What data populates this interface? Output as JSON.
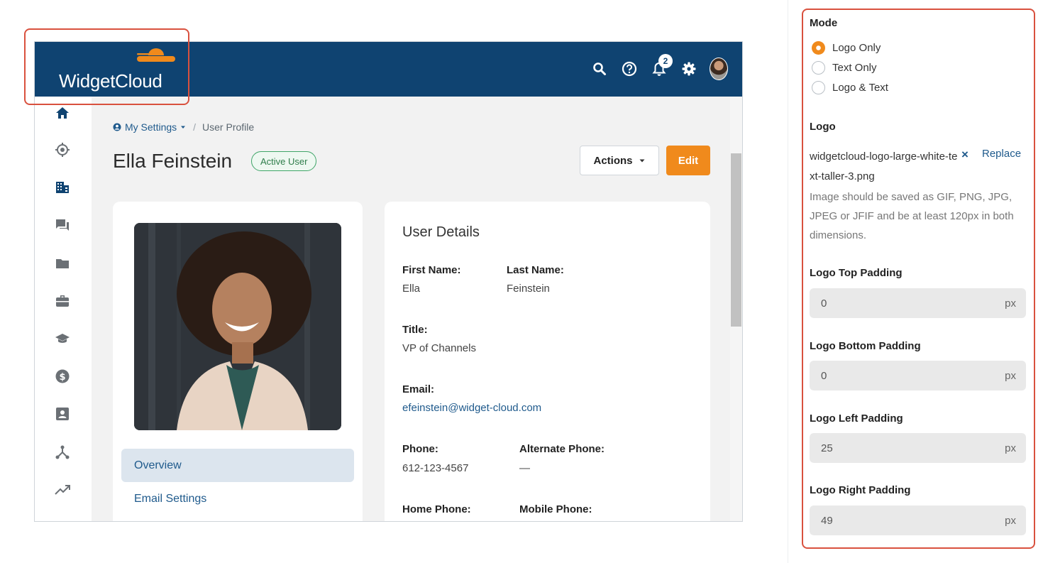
{
  "header": {
    "brand": "WidgetCloud",
    "notifications_count": "2"
  },
  "breadcrumb": {
    "root": "My Settings",
    "current": "User Profile"
  },
  "profile": {
    "name": "Ella Feinstein",
    "status": "Active User",
    "actions_label": "Actions",
    "edit_label": "Edit"
  },
  "profile_nav": [
    "Overview",
    "Email Settings"
  ],
  "details": {
    "title": "User Details",
    "first_name_label": "First Name:",
    "first_name": "Ella",
    "last_name_label": "Last Name:",
    "last_name": "Feinstein",
    "title_label": "Title:",
    "title_value": "VP of Channels",
    "email_label": "Email:",
    "email": "efeinstein@widget-cloud.com",
    "phone_label": "Phone:",
    "phone": "612-123-4567",
    "alt_phone_label": "Alternate Phone:",
    "alt_phone": "—",
    "home_phone_label": "Home Phone:",
    "mobile_phone_label": "Mobile Phone:"
  },
  "settings": {
    "mode_label": "Mode",
    "mode_options": [
      "Logo Only",
      "Text Only",
      "Logo & Text"
    ],
    "mode_selected": "Logo Only",
    "logo_label": "Logo",
    "logo_file": "widgetcloud-logo-large-white-text-taller-3.png",
    "replace_label": "Replace",
    "hint": "Image should be saved as GIF, PNG, JPG, JPEG or JFIF and be at least 120px in both dimensions.",
    "top_padding_label": "Logo Top Padding",
    "top_padding": "0",
    "bottom_padding_label": "Logo Bottom Padding",
    "bottom_padding": "0",
    "left_padding_label": "Logo Left Padding",
    "left_padding": "25",
    "right_padding_label": "Logo Right Padding",
    "right_padding": "49",
    "unit": "px"
  },
  "colors": {
    "header_bg": "#0f4371",
    "accent": "#f08a1c",
    "highlight": "#d9513e",
    "link": "#1f5a8c"
  }
}
